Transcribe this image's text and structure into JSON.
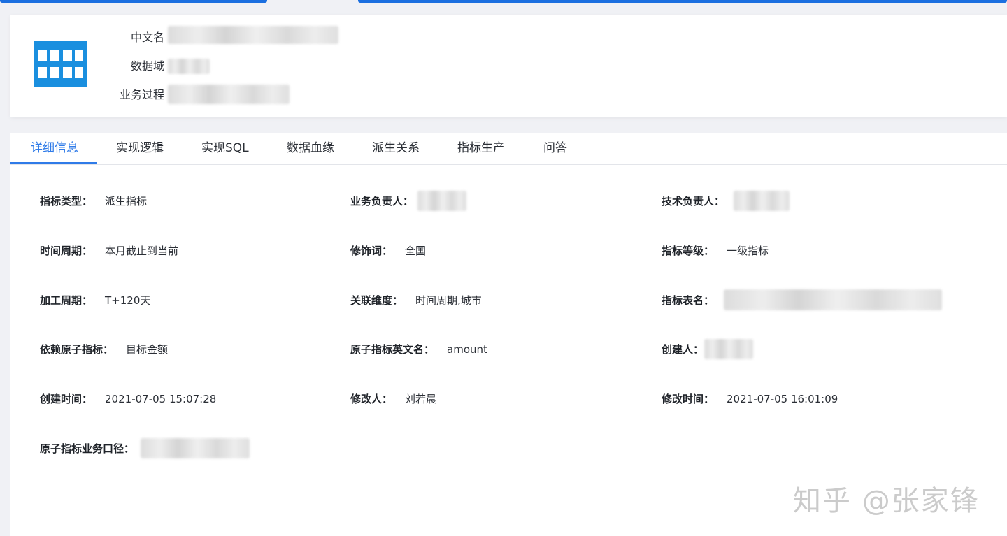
{
  "header": {
    "labels": {
      "chinese_name": "中文名",
      "data_domain": "数据域",
      "business_process": "业务过程"
    }
  },
  "tabs": [
    {
      "label": "详细信息",
      "active": true
    },
    {
      "label": "实现逻辑",
      "active": false
    },
    {
      "label": "实现SQL",
      "active": false
    },
    {
      "label": "数据血缘",
      "active": false
    },
    {
      "label": "派生关系",
      "active": false
    },
    {
      "label": "指标生产",
      "active": false
    },
    {
      "label": "问答",
      "active": false
    }
  ],
  "fields": {
    "metric_type": {
      "label": "指标类型：",
      "value": "派生指标"
    },
    "business_owner": {
      "label": "业务负责人："
    },
    "tech_owner": {
      "label": "技术负责人："
    },
    "time_period": {
      "label": "时间周期：",
      "value": "本月截止到当前"
    },
    "modifier": {
      "label": "修饰词：",
      "value": "全国"
    },
    "metric_level": {
      "label": "指标等级：",
      "value": "一级指标"
    },
    "process_cycle": {
      "label": "加工周期：",
      "value": "T+120天"
    },
    "related_dims": {
      "label": "关联维度：",
      "value": "时间周期,城市"
    },
    "metric_table": {
      "label": "指标表名："
    },
    "atomic_metric": {
      "label": "依赖原子指标：",
      "value": "目标金额"
    },
    "atomic_metric_en": {
      "label": "原子指标英文名：",
      "value": "amount"
    },
    "creator": {
      "label": "创建人："
    },
    "created_time": {
      "label": "创建时间：",
      "value": "2021-07-05 15:07:28"
    },
    "modified_by": {
      "label": "修改人：",
      "value": "刘若晨"
    },
    "modified_time": {
      "label": "修改时间：",
      "value": "2021-07-05 16:01:09"
    },
    "atomic_business_def": {
      "label": "原子指标业务口径："
    }
  },
  "watermark": "知乎 @张家锋",
  "colors": {
    "accent": "#2f7be8",
    "logo": "#1a8fdf",
    "topbar": "#1b6fe0"
  },
  "icons": {
    "logo": "table-grid-icon"
  }
}
